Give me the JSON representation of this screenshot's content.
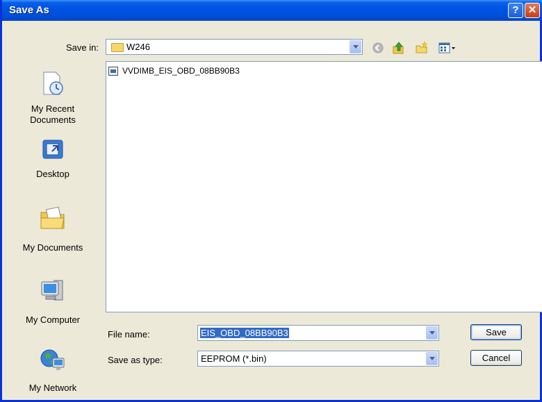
{
  "window": {
    "title": "Save As",
    "help_label": "?",
    "close_label": "✕"
  },
  "save_in": {
    "label": "Save in:",
    "value": "W246"
  },
  "toolbar": {
    "icons": [
      "back-icon",
      "up-folder-icon",
      "new-folder-icon",
      "views-menu-icon"
    ]
  },
  "places": [
    {
      "label": "My Recent\nDocuments",
      "icon": "recent-documents-icon"
    },
    {
      "label": "Desktop",
      "icon": "desktop-icon"
    },
    {
      "label": "My Documents",
      "icon": "my-documents-icon"
    },
    {
      "label": "My Computer",
      "icon": "my-computer-icon"
    },
    {
      "label": "My Network",
      "icon": "my-network-icon"
    }
  ],
  "files": [
    {
      "name": "VVDIMB_EIS_OBD_08BB90B3"
    }
  ],
  "filename": {
    "label": "File name:",
    "value": "EIS_OBD_08BB90B3"
  },
  "filetype": {
    "label": "Save as type:",
    "value": "EEPROM (*.bin)"
  },
  "buttons": {
    "save": "Save",
    "cancel": "Cancel"
  },
  "colors": {
    "title_bar": "#0054e3",
    "selection": "#316ac5",
    "face": "#ece9d8"
  }
}
